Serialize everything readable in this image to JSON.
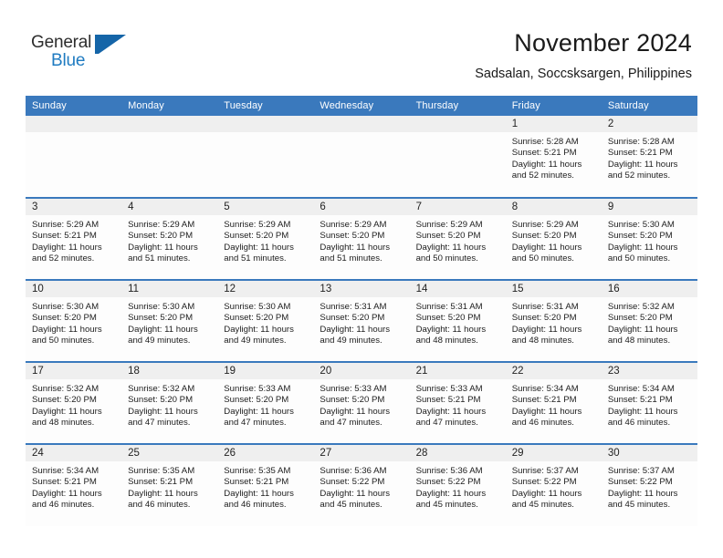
{
  "brand": {
    "name_part1": "General",
    "name_part2": "Blue",
    "mark": "blue-triangle-logo",
    "accent_color": "#1565a8"
  },
  "header": {
    "title": "November 2024",
    "subtitle": "Sadsalan, Soccsksargen, Philippines"
  },
  "theme": {
    "header_blue": "#3a79bd",
    "daynum_band": "#efefef",
    "cell_bg": "#fdfdfd",
    "text": "#1d1d1d"
  },
  "weekday_headers": [
    "Sunday",
    "Monday",
    "Tuesday",
    "Wednesday",
    "Thursday",
    "Friday",
    "Saturday"
  ],
  "weeks": [
    [
      {
        "day": "",
        "empty": true,
        "sunrise": "",
        "sunset": "",
        "daylight1": "",
        "daylight2": ""
      },
      {
        "day": "",
        "empty": true,
        "sunrise": "",
        "sunset": "",
        "daylight1": "",
        "daylight2": ""
      },
      {
        "day": "",
        "empty": true,
        "sunrise": "",
        "sunset": "",
        "daylight1": "",
        "daylight2": ""
      },
      {
        "day": "",
        "empty": true,
        "sunrise": "",
        "sunset": "",
        "daylight1": "",
        "daylight2": ""
      },
      {
        "day": "",
        "empty": true,
        "sunrise": "",
        "sunset": "",
        "daylight1": "",
        "daylight2": ""
      },
      {
        "day": "1",
        "empty": false,
        "sunrise": "Sunrise: 5:28 AM",
        "sunset": "Sunset: 5:21 PM",
        "daylight1": "Daylight: 11 hours",
        "daylight2": "and 52 minutes."
      },
      {
        "day": "2",
        "empty": false,
        "sunrise": "Sunrise: 5:28 AM",
        "sunset": "Sunset: 5:21 PM",
        "daylight1": "Daylight: 11 hours",
        "daylight2": "and 52 minutes."
      }
    ],
    [
      {
        "day": "3",
        "empty": false,
        "sunrise": "Sunrise: 5:29 AM",
        "sunset": "Sunset: 5:21 PM",
        "daylight1": "Daylight: 11 hours",
        "daylight2": "and 52 minutes."
      },
      {
        "day": "4",
        "empty": false,
        "sunrise": "Sunrise: 5:29 AM",
        "sunset": "Sunset: 5:20 PM",
        "daylight1": "Daylight: 11 hours",
        "daylight2": "and 51 minutes."
      },
      {
        "day": "5",
        "empty": false,
        "sunrise": "Sunrise: 5:29 AM",
        "sunset": "Sunset: 5:20 PM",
        "daylight1": "Daylight: 11 hours",
        "daylight2": "and 51 minutes."
      },
      {
        "day": "6",
        "empty": false,
        "sunrise": "Sunrise: 5:29 AM",
        "sunset": "Sunset: 5:20 PM",
        "daylight1": "Daylight: 11 hours",
        "daylight2": "and 51 minutes."
      },
      {
        "day": "7",
        "empty": false,
        "sunrise": "Sunrise: 5:29 AM",
        "sunset": "Sunset: 5:20 PM",
        "daylight1": "Daylight: 11 hours",
        "daylight2": "and 50 minutes."
      },
      {
        "day": "8",
        "empty": false,
        "sunrise": "Sunrise: 5:29 AM",
        "sunset": "Sunset: 5:20 PM",
        "daylight1": "Daylight: 11 hours",
        "daylight2": "and 50 minutes."
      },
      {
        "day": "9",
        "empty": false,
        "sunrise": "Sunrise: 5:30 AM",
        "sunset": "Sunset: 5:20 PM",
        "daylight1": "Daylight: 11 hours",
        "daylight2": "and 50 minutes."
      }
    ],
    [
      {
        "day": "10",
        "empty": false,
        "sunrise": "Sunrise: 5:30 AM",
        "sunset": "Sunset: 5:20 PM",
        "daylight1": "Daylight: 11 hours",
        "daylight2": "and 50 minutes."
      },
      {
        "day": "11",
        "empty": false,
        "sunrise": "Sunrise: 5:30 AM",
        "sunset": "Sunset: 5:20 PM",
        "daylight1": "Daylight: 11 hours",
        "daylight2": "and 49 minutes."
      },
      {
        "day": "12",
        "empty": false,
        "sunrise": "Sunrise: 5:30 AM",
        "sunset": "Sunset: 5:20 PM",
        "daylight1": "Daylight: 11 hours",
        "daylight2": "and 49 minutes."
      },
      {
        "day": "13",
        "empty": false,
        "sunrise": "Sunrise: 5:31 AM",
        "sunset": "Sunset: 5:20 PM",
        "daylight1": "Daylight: 11 hours",
        "daylight2": "and 49 minutes."
      },
      {
        "day": "14",
        "empty": false,
        "sunrise": "Sunrise: 5:31 AM",
        "sunset": "Sunset: 5:20 PM",
        "daylight1": "Daylight: 11 hours",
        "daylight2": "and 48 minutes."
      },
      {
        "day": "15",
        "empty": false,
        "sunrise": "Sunrise: 5:31 AM",
        "sunset": "Sunset: 5:20 PM",
        "daylight1": "Daylight: 11 hours",
        "daylight2": "and 48 minutes."
      },
      {
        "day": "16",
        "empty": false,
        "sunrise": "Sunrise: 5:32 AM",
        "sunset": "Sunset: 5:20 PM",
        "daylight1": "Daylight: 11 hours",
        "daylight2": "and 48 minutes."
      }
    ],
    [
      {
        "day": "17",
        "empty": false,
        "sunrise": "Sunrise: 5:32 AM",
        "sunset": "Sunset: 5:20 PM",
        "daylight1": "Daylight: 11 hours",
        "daylight2": "and 48 minutes."
      },
      {
        "day": "18",
        "empty": false,
        "sunrise": "Sunrise: 5:32 AM",
        "sunset": "Sunset: 5:20 PM",
        "daylight1": "Daylight: 11 hours",
        "daylight2": "and 47 minutes."
      },
      {
        "day": "19",
        "empty": false,
        "sunrise": "Sunrise: 5:33 AM",
        "sunset": "Sunset: 5:20 PM",
        "daylight1": "Daylight: 11 hours",
        "daylight2": "and 47 minutes."
      },
      {
        "day": "20",
        "empty": false,
        "sunrise": "Sunrise: 5:33 AM",
        "sunset": "Sunset: 5:20 PM",
        "daylight1": "Daylight: 11 hours",
        "daylight2": "and 47 minutes."
      },
      {
        "day": "21",
        "empty": false,
        "sunrise": "Sunrise: 5:33 AM",
        "sunset": "Sunset: 5:21 PM",
        "daylight1": "Daylight: 11 hours",
        "daylight2": "and 47 minutes."
      },
      {
        "day": "22",
        "empty": false,
        "sunrise": "Sunrise: 5:34 AM",
        "sunset": "Sunset: 5:21 PM",
        "daylight1": "Daylight: 11 hours",
        "daylight2": "and 46 minutes."
      },
      {
        "day": "23",
        "empty": false,
        "sunrise": "Sunrise: 5:34 AM",
        "sunset": "Sunset: 5:21 PM",
        "daylight1": "Daylight: 11 hours",
        "daylight2": "and 46 minutes."
      }
    ],
    [
      {
        "day": "24",
        "empty": false,
        "sunrise": "Sunrise: 5:34 AM",
        "sunset": "Sunset: 5:21 PM",
        "daylight1": "Daylight: 11 hours",
        "daylight2": "and 46 minutes."
      },
      {
        "day": "25",
        "empty": false,
        "sunrise": "Sunrise: 5:35 AM",
        "sunset": "Sunset: 5:21 PM",
        "daylight1": "Daylight: 11 hours",
        "daylight2": "and 46 minutes."
      },
      {
        "day": "26",
        "empty": false,
        "sunrise": "Sunrise: 5:35 AM",
        "sunset": "Sunset: 5:21 PM",
        "daylight1": "Daylight: 11 hours",
        "daylight2": "and 46 minutes."
      },
      {
        "day": "27",
        "empty": false,
        "sunrise": "Sunrise: 5:36 AM",
        "sunset": "Sunset: 5:22 PM",
        "daylight1": "Daylight: 11 hours",
        "daylight2": "and 45 minutes."
      },
      {
        "day": "28",
        "empty": false,
        "sunrise": "Sunrise: 5:36 AM",
        "sunset": "Sunset: 5:22 PM",
        "daylight1": "Daylight: 11 hours",
        "daylight2": "and 45 minutes."
      },
      {
        "day": "29",
        "empty": false,
        "sunrise": "Sunrise: 5:37 AM",
        "sunset": "Sunset: 5:22 PM",
        "daylight1": "Daylight: 11 hours",
        "daylight2": "and 45 minutes."
      },
      {
        "day": "30",
        "empty": false,
        "sunrise": "Sunrise: 5:37 AM",
        "sunset": "Sunset: 5:22 PM",
        "daylight1": "Daylight: 11 hours",
        "daylight2": "and 45 minutes."
      }
    ]
  ]
}
